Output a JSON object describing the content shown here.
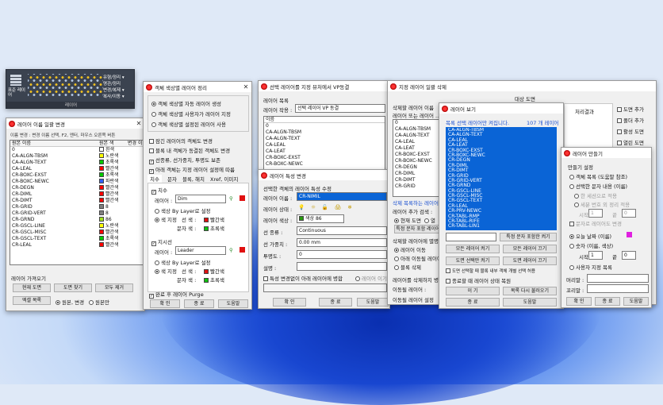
{
  "ribbon": {
    "title": "레이어",
    "items": [
      "유형/정리 ▾",
      "명관/정리",
      "변경/복제 ▾",
      "복사/이동 ▾"
    ],
    "big": "표준 레이어"
  },
  "w1": {
    "title": "레이어 이름 일괄 변경",
    "filter": "이름 변경 : 변경 이름 선택, F2, 엔터, 마우스 오른쪽 버튼",
    "h1": "원본 이름",
    "h2": "원본 색",
    "h3": "변경 이",
    "rows": [
      [
        "0",
        "흰색",
        "#ffffff"
      ],
      [
        "CA-ALGN-TBSM",
        "노란색",
        "#ffff00"
      ],
      [
        "CA-ALGN-TEXT",
        "초록색",
        "#00cc00"
      ],
      [
        "CA-LEAL",
        "빨간색",
        "#ff0000"
      ],
      [
        "CR-BOXC-EXST",
        "초록색",
        "#00cc00"
      ],
      [
        "CR-BOXC-NEWC",
        "파란색",
        "#3060ff"
      ],
      [
        "CR-DEGN",
        "빨간색",
        "#ff0000"
      ],
      [
        "CR-DIML",
        "빨간색",
        "#ff0000"
      ],
      [
        "CR-DIMT",
        "빨간색",
        "#ff0000"
      ],
      [
        "CR-GRID",
        "8",
        "#808080"
      ],
      [
        "CR-GRID-VERT",
        "8",
        "#808080"
      ],
      [
        "CR-GRND",
        "86",
        "#a0e020"
      ],
      [
        "CR-GSCL-LINE",
        "노란색",
        "#ffff00"
      ],
      [
        "CR-GSCL-MISC",
        "빨간색",
        "#ff0000"
      ],
      [
        "CR-GSCL-TEXT",
        "초록색",
        "#00cc00"
      ],
      [
        "CR-LEAL",
        "빨간색",
        "#ff0000"
      ]
    ],
    "sect": "레이어 가져오기",
    "b1": "현재 도면",
    "b2": "도면 찾기",
    "b3": "모두 제거",
    "b4": "엑셀 목록",
    "r1": "원본, 변경",
    "r2": "원본만"
  },
  "w2": {
    "title": "객체 색상별 레이어 정리",
    "o1": "객체 색상별 자동 레이어 생성",
    "o2": "객체 색상별 사용자가 레이어 지정",
    "o3": "객체 색상별 설정된 레이어 사용",
    "c1": "잠긴 레이어의 객체도 변경",
    "c2": "블록 내 객체가 동결된 객체도 변경",
    "c3": "선종류, 선가중치, 투명도 보존",
    "c4": "아래 객체는 지정 레이어 설정에 따름",
    "tabs": [
      "치수",
      "문자",
      "블록, 해치",
      "Xref, 이미지"
    ],
    "g1": "치수",
    "lay": "레이어 :",
    "v1": "Dim",
    "rb1": "색상 By Layer로 설정",
    "rb2": "색 지정",
    "lc": "선 색 :",
    "tc": "문자 색 :",
    "red": "빨간색",
    "grn": "초록색",
    "g2": "지시선",
    "v2": "Leader",
    "purge": "완료 후 레이어 Purge",
    "ok": "확 인",
    "cancel": "종 료",
    "help": "도움말"
  },
  "w3": {
    "title": "선택 레이어를 지정 뷰처에서 VP동결",
    "sec": "레이어 목록",
    "vplabel": "레이어 작용 :",
    "vp": "선택 레이어 VP 동결",
    "colname": "이름",
    "rows": [
      "0",
      "CA-ALGN-TBSM",
      "CA-ALGN-TEXT",
      "CA-LEAL",
      "CA-LEAT",
      "CR-BOXC-EXST",
      "CR-BOXC-NEWC"
    ]
  },
  "w4": {
    "title": "레이어 특성 변경",
    "hint": "선택한 객체의 레이어 특성 수정",
    "l1": "레이어 이름 :",
    "v1": "CR-NIMIL",
    "l2": "레이어 상태 :",
    "l3": "레이어 색상 :",
    "v3": "색상 86",
    "l4": "선 종류 :",
    "v4": "Continuous",
    "l5": "선 가중치 :",
    "v5": "0.00 mm",
    "l6": "투명도 :",
    "v6": "0",
    "l7": "설명 :",
    "chk": "특성 변경없이 아래 레이어에 병합",
    "opt": "레이어 이기",
    "ok": "확 인",
    "cancel": "종 료",
    "help": "도움말"
  },
  "w5": {
    "title": "지정 레이어 일괄 삭제",
    "top": "대상 도면",
    "s1": "삭제할 레이어 이름",
    "s2": "레이어 또는 레이어 ...",
    "rows": [
      "0",
      "CA-ALGN-TBSM",
      "CA-ALGN-TEXT",
      "CA-LEAL",
      "CA-LEAT",
      "CR-BOXC-EXST",
      "CR-BOXC-NEWC",
      "CR-DEGN",
      "CR-DIML",
      "CR-DIMT",
      "CR-GRID"
    ],
    "hint": "삭제 목록하는 레이어",
    "add": "레이어 추가 검색 :",
    "r1": "현재 도면",
    "r2": "열",
    "spec": "특정 문자 포함 레이어",
    "del": "삭제할 레이어에 별명",
    "ra": "레이어 이동",
    "rb": "아래 이동될 레이어",
    "rc": "블록 삭제",
    "g3": "처리 이름",
    "l1": "레이어를 삭제하지 병합",
    "l2": "이동될 레이어 :",
    "l3": "이동될 레이어 설정",
    "right": "처리결과",
    "rb1": "도면 추가",
    "rb2": "폴더 추가",
    "rb3": "활성 도면",
    "rb4": "열린 도면"
  },
  "w6": {
    "title": "레이어 보기",
    "hint": "목록 선택 레이어만 켜집니다.",
    "count": "107 개 레이어",
    "rows": [
      "CA-ALGN-TBSM",
      "CA-ALGN-TEXT",
      "CA-LEAL",
      "CA-LEAT",
      "CR-BOXC-EXST",
      "CR-BOXC-NEWC",
      "CR-DEGN",
      "CR-DIML",
      "CR-DIMT",
      "CR-GRID",
      "CR-GRID-VERT",
      "CR-GRND",
      "CR-GSCL-LINE",
      "CR-GSCL-MISC",
      "CR-GSCL-TEXT",
      "CR-LEAL",
      "CR-PRV-NEWC",
      "CR-TABL-RMP",
      "CR-TABL-RIFE",
      "CR-TABL-LIN1"
    ],
    "b1": "특정 문자 포함한 켜기",
    "b2": "모든 레이어 켜기",
    "b3": "모든 레이어 끄기",
    "b4": "도면 선택만 켜기",
    "b5": "도면 레이어 끄기",
    "c1": "도면 선택할 때 블록 내부 객체 개별 선택 허용",
    "c2": "종료할 때 레이어 상태 복원",
    "b6": "이 기",
    "b7": "목록 다시 불러오기",
    "ok": "종 료",
    "help": "도움말"
  },
  "w7": {
    "title": "레이어 만들기",
    "g": "만들기 설정",
    "o1": "객체 목록 (도움말 참조)",
    "o2": "선택한 문자 내용 (이름)",
    "o3": "한 세션으로 적용",
    "o4": "세분 번호 외 정리 적용",
    "o5": "문자로 레이어도 변경",
    "start": "시작",
    "end": "끝",
    "s1": "1",
    "s2": "0",
    "o6": "오늘 날짜 (이름)",
    "o7": "숫자 (이름, 색상)",
    "o8": "사용자 지정 목록",
    "pre": "머리말 :",
    "suf": "꼬리말 :",
    "ok": "확 인",
    "cancel": "종 료",
    "help": "도움말"
  }
}
